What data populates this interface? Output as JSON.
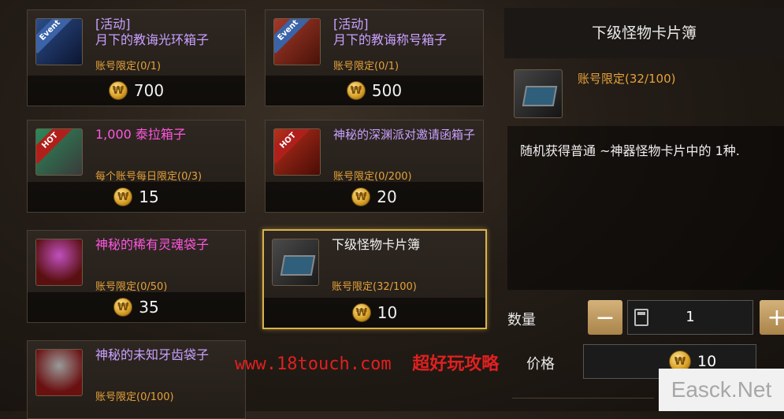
{
  "items": [
    {
      "badge": "Event",
      "tag": "[活动]",
      "name": "月下的教诲光环箱子",
      "limit": "账号限定(0/1)",
      "price": "700"
    },
    {
      "badge": "Event",
      "tag": "[活动]",
      "name": "月下的教诲称号箱子",
      "limit": "账号限定(0/1)",
      "price": "500"
    },
    {
      "badge": "HOT",
      "name": "1,000 泰拉箱子",
      "limit": "每个账号每日限定(0/3)",
      "price": "15"
    },
    {
      "badge": "HOT",
      "name": "神秘的深渊派对邀请函箱子",
      "limit": "账号限定(0/200)",
      "price": "20"
    },
    {
      "name": "神秘的稀有灵魂袋子",
      "limit": "账号限定(0/50)",
      "price": "35"
    },
    {
      "name": "下级怪物卡片簿",
      "limit": "账号限定(32/100)",
      "price": "10"
    },
    {
      "name": "神秘的未知牙齿袋子",
      "limit": "账号限定(0/100)"
    }
  ],
  "detail": {
    "title": "下级怪物卡片簿",
    "limit": "账号限定(32/100)",
    "description": "随机获得普通 ~神器怪物卡片中的 1种.",
    "quantity_label": "数量",
    "quantity": "1",
    "minus": "−",
    "plus": "+",
    "price_label": "价格",
    "price": "10"
  },
  "coin_glyph": "₩",
  "watermark": {
    "url": "www.18touch.com",
    "cn": "超好玩攻略",
    "logo": "Easck.Net"
  },
  "colors": {
    "accent": "#d9b24b",
    "limit": "#e4a23a",
    "pink": "#ff56e0",
    "purple": "#c9a0ff"
  }
}
